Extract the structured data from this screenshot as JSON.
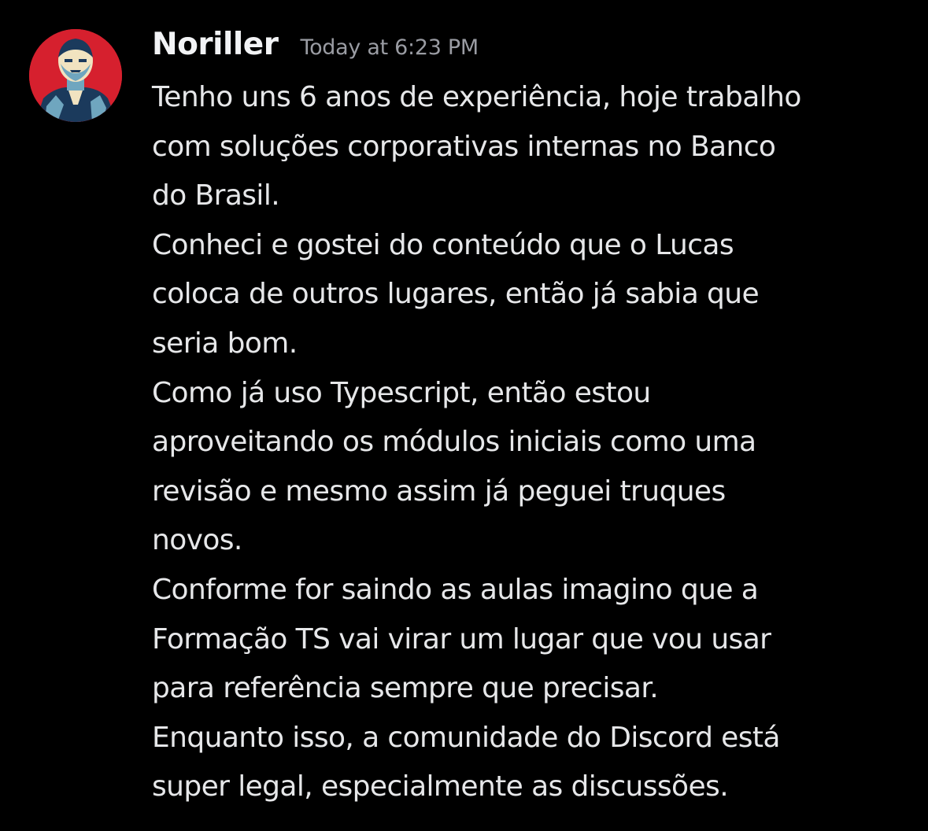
{
  "message": {
    "author": "Noriller",
    "timestamp": "Today at 6:23 PM",
    "avatar_icon": "user-avatar",
    "avatar_colors": [
      "#d6202e",
      "#1b3a5c",
      "#6fa6bf",
      "#f1e3c0"
    ],
    "lines": [
      "Tenho uns 6 anos de experiência, hoje trabalho",
      "com soluções corporativas internas no Banco",
      "do Brasil.",
      "Conheci e gostei do conteúdo que o Lucas",
      "coloca de outros lugares, então já sabia que",
      "seria bom.",
      "Como já uso Typescript, então estou",
      "aproveitando os módulos iniciais como uma",
      "revisão e mesmo assim já peguei truques",
      "novos.",
      "Conforme for saindo as aulas imagino que a",
      "Formação TS vai virar um lugar que vou usar",
      "para referência sempre que precisar.",
      "Enquanto isso, a comunidade do Discord está",
      "super legal, especialmente as discussões."
    ]
  }
}
